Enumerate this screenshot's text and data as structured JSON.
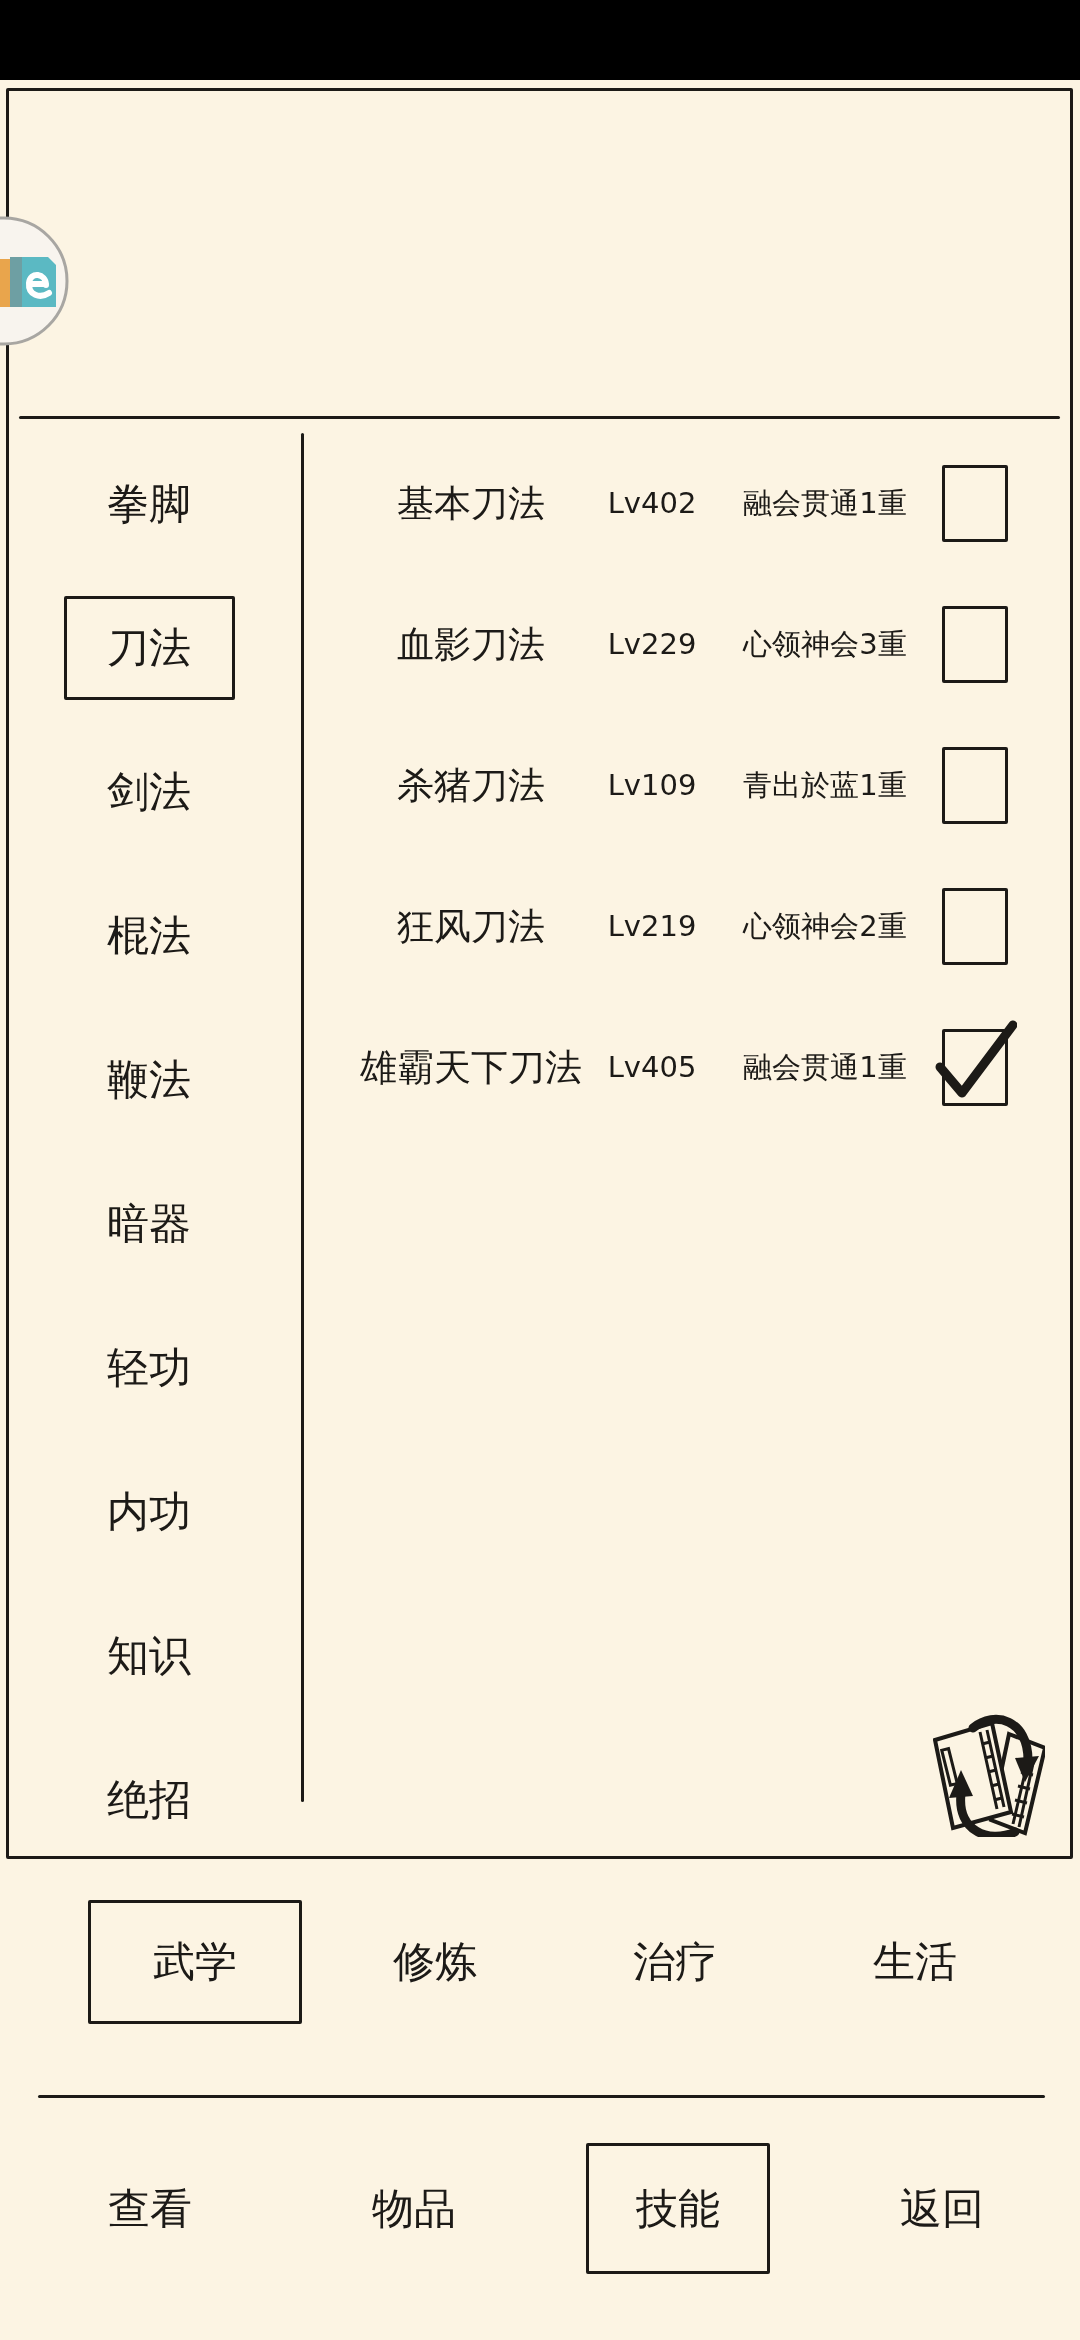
{
  "skill_types": [
    {
      "label": "拳脚",
      "selected": false
    },
    {
      "label": "刀法",
      "selected": true
    },
    {
      "label": "剑法",
      "selected": false
    },
    {
      "label": "棍法",
      "selected": false
    },
    {
      "label": "鞭法",
      "selected": false
    },
    {
      "label": "暗器",
      "selected": false
    },
    {
      "label": "轻功",
      "selected": false
    },
    {
      "label": "内功",
      "selected": false
    },
    {
      "label": "知识",
      "selected": false
    },
    {
      "label": "绝招",
      "selected": false
    }
  ],
  "skills": [
    {
      "name": "基本刀法",
      "lv": "Lv402",
      "realm": "融会贯通1重",
      "checked": false
    },
    {
      "name": "血影刀法",
      "lv": "Lv229",
      "realm": "心领神会3重",
      "checked": false
    },
    {
      "name": "杀猪刀法",
      "lv": "Lv109",
      "realm": "青出於蓝1重",
      "checked": false
    },
    {
      "name": "狂风刀法",
      "lv": "Lv219",
      "realm": "心领神会2重",
      "checked": false
    },
    {
      "name": "雄霸天下刀法",
      "lv": "Lv405",
      "realm": "融会贯通1重",
      "checked": true
    }
  ],
  "categories": [
    {
      "label": "武学",
      "selected": true
    },
    {
      "label": "修炼",
      "selected": false
    },
    {
      "label": "治疗",
      "selected": false
    },
    {
      "label": "生活",
      "selected": false
    }
  ],
  "nav": [
    {
      "label": "查看",
      "selected": false
    },
    {
      "label": "物品",
      "selected": false
    },
    {
      "label": "技能",
      "selected": true
    },
    {
      "label": "返回",
      "selected": false
    }
  ]
}
